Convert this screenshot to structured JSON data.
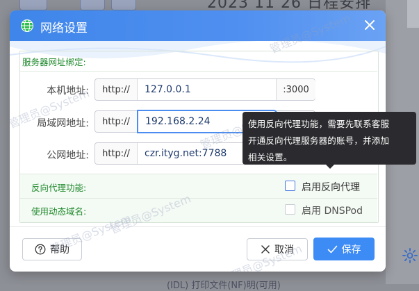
{
  "background": {
    "title_fragment": "2023 11 26 日程安排",
    "bottom_fragment": "(IDL) 打印文件(NF)明(可用)"
  },
  "dialog": {
    "title": "网络设置",
    "section_title": "服务器网址绑定:",
    "rows": [
      {
        "label": "本机地址:",
        "prefix": "http://",
        "value": "127.0.0.1",
        "suffix": ":3000"
      },
      {
        "label": "局域网地址:",
        "prefix": "http://",
        "value": "192.168.2.24",
        "suffix": ""
      },
      {
        "label": "公网地址:",
        "prefix": "http://",
        "value": "czr.ityg.net:7788",
        "suffix": ""
      }
    ],
    "features": [
      {
        "label": "反向代理功能:",
        "option": "启用反向代理",
        "checked": false
      },
      {
        "label": "使用动态域名:",
        "option": "启用 DNSPod",
        "checked": false
      }
    ],
    "tooltip": [
      "使用反向代理功能，需要先联系客服",
      "开通反向代理服务器的账号，并添加",
      "相关设置。"
    ],
    "buttons": {
      "help": "帮助",
      "cancel": "取消",
      "save": "保存"
    }
  },
  "watermark": "管理员@System",
  "colors": {
    "header": "#4f8ff0",
    "section_green": "#1f8a2c",
    "primary": "#3d8bf5"
  }
}
